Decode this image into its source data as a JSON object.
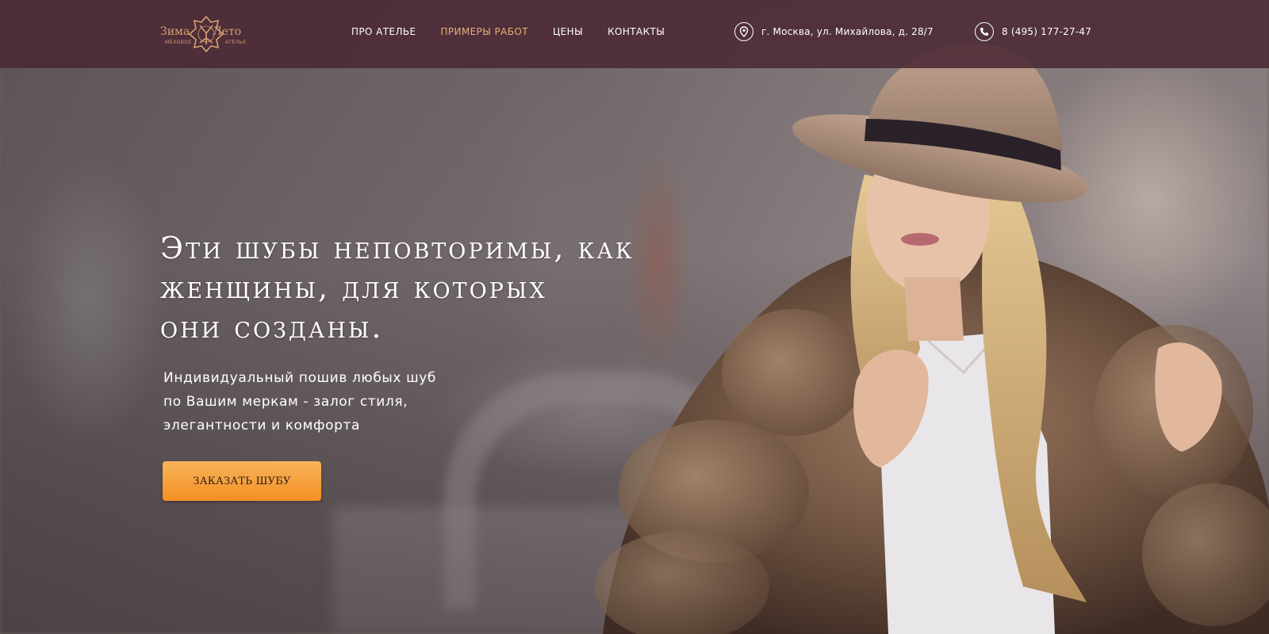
{
  "header": {
    "logo": {
      "word_left": "Зима",
      "word_right": "Лето",
      "sub_left": "МЕХОВОЕ",
      "sub_right": "АТЕЛЬЕ"
    },
    "nav": [
      {
        "label": "ПРО АТЕЛЬЕ",
        "active": false
      },
      {
        "label": "ПРИМЕРЫ РАБОТ",
        "active": true
      },
      {
        "label": "ЦЕНЫ",
        "active": false
      },
      {
        "label": "КОНТАКТЫ",
        "active": false
      }
    ],
    "address": "г. Москва, ул. Михайлова, д. 28/7",
    "phone": "8 (495) 177-27-47",
    "colors": {
      "bar": "#4a2834",
      "accent": "#e6b07a",
      "logo": "#d7a172"
    },
    "icons": {
      "address": "map-pin-icon",
      "phone": "phone-icon"
    }
  },
  "hero": {
    "title_lines": [
      "Эти шубы неповторимы, как",
      "женщины, для которых",
      "они созданы."
    ],
    "subtitle_lines": [
      "Индивидуальный пошив любых шуб",
      "по Вашим меркам - залог стиля,",
      "элегантности и комфорта"
    ],
    "cta_label": "ЗАКАЗАТЬ ШУБУ",
    "cta_color": "#f7a13f"
  }
}
